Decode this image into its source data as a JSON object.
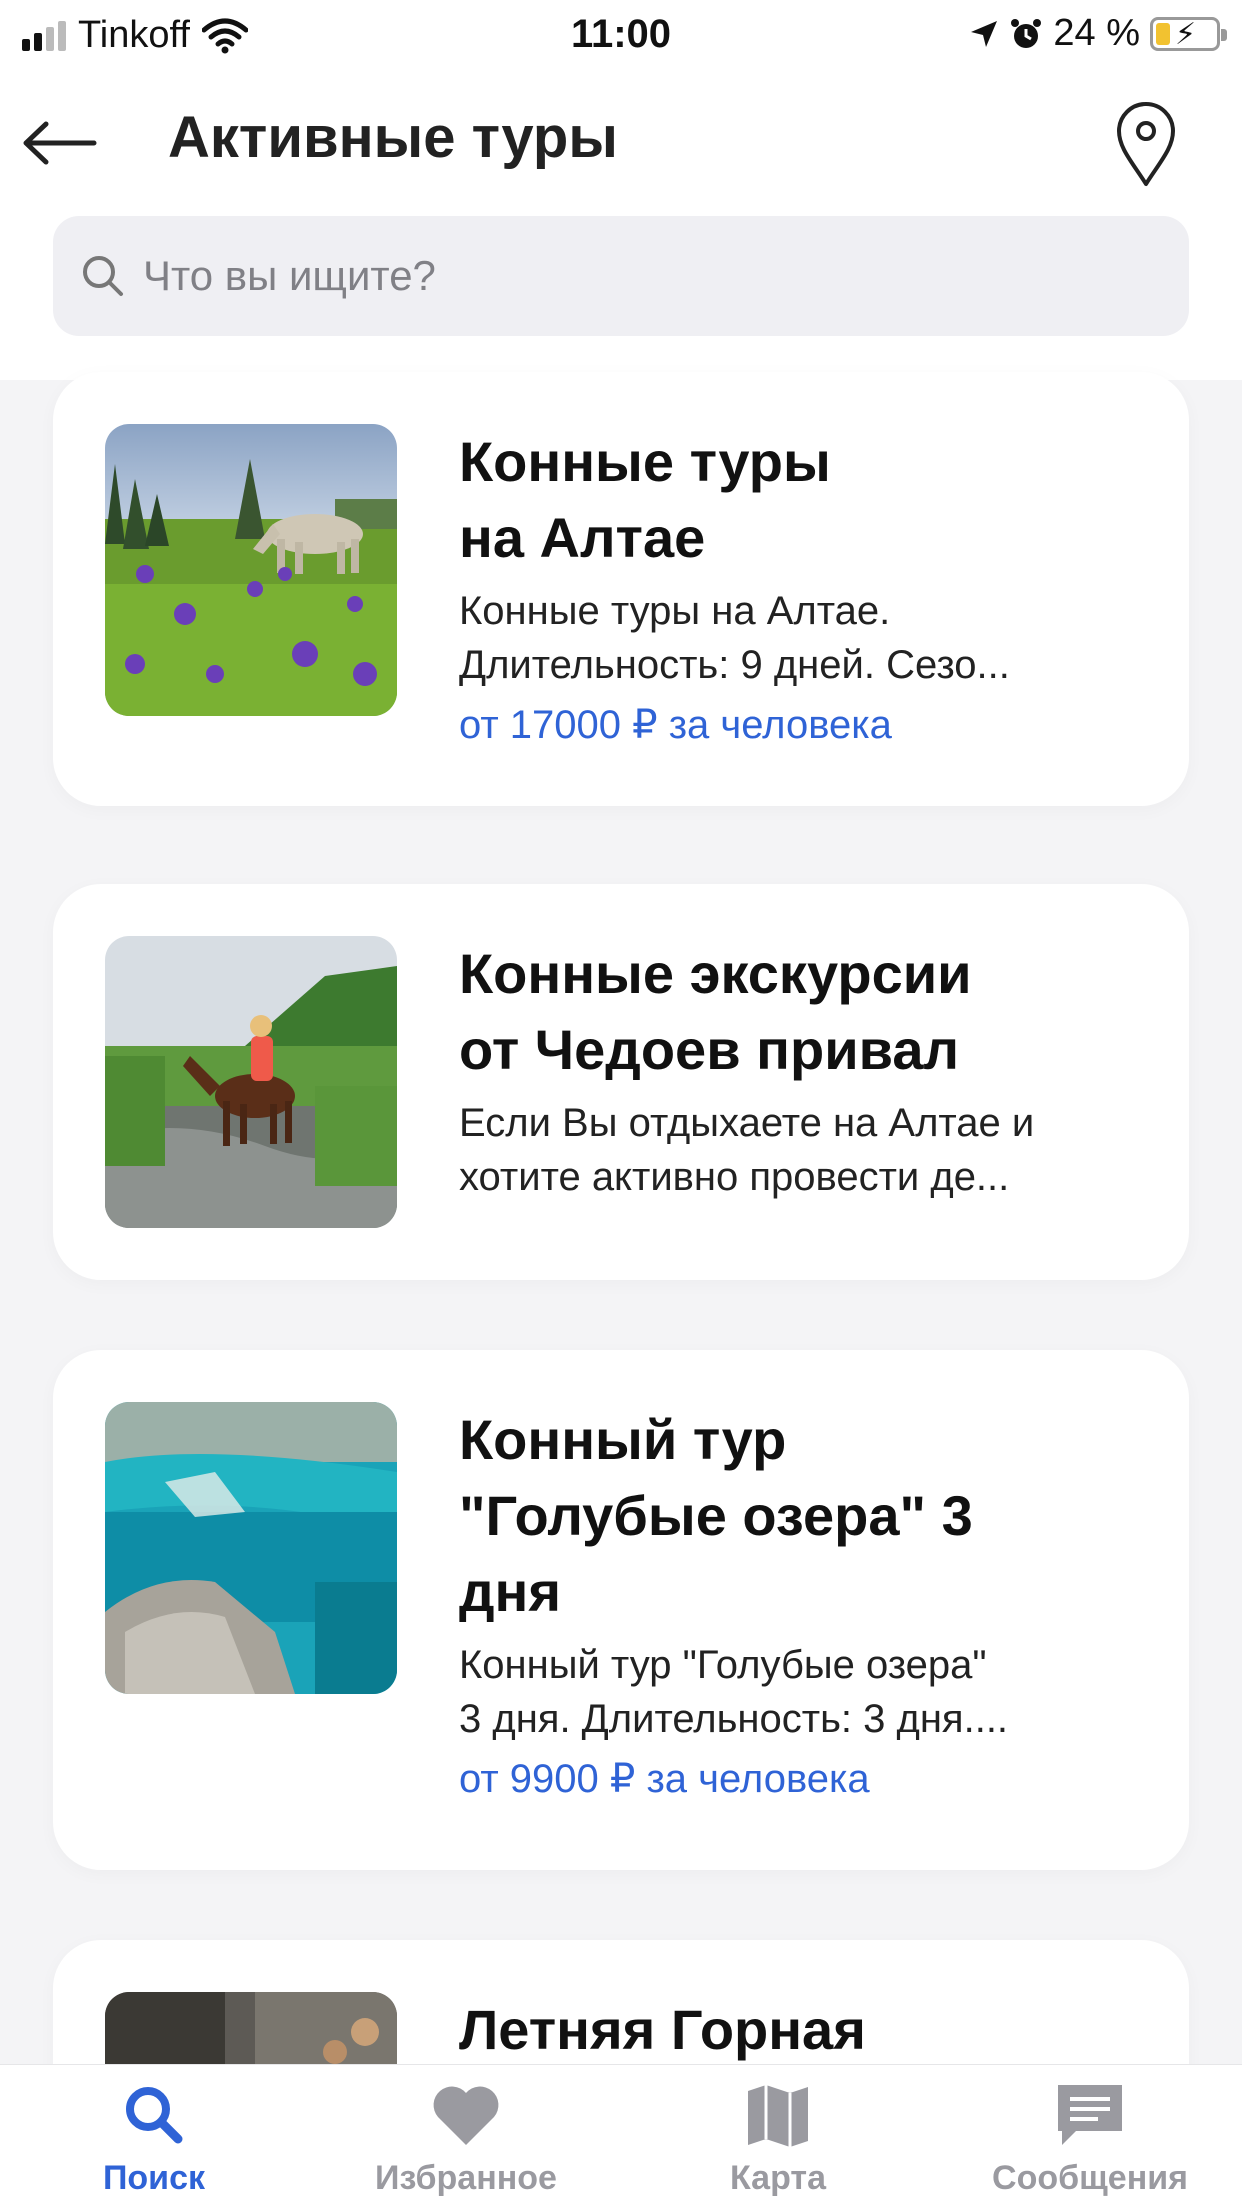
{
  "status_bar": {
    "carrier": "Tinkoff",
    "time": "11:00",
    "battery_percent": "24 %",
    "battery_level": 0.24
  },
  "header": {
    "title": "Активные туры",
    "search_placeholder": "Что вы ищите?"
  },
  "cards": [
    {
      "title_lines": [
        "Конные туры",
        "на Алтае"
      ],
      "desc_lines": [
        "Конные туры на Алтае.",
        "Длительность: 9 дней. Сезо..."
      ],
      "price": "от 17000 ₽ за человека"
    },
    {
      "title_lines": [
        "Конные экскурсии",
        "от Чедоев привал"
      ],
      "desc_lines": [
        "Если Вы отдыхаете на Алтае и",
        "хотите активно провести де..."
      ]
    },
    {
      "title_lines": [
        "Конный тур",
        "\"Голубые озера\" 3",
        "дня"
      ],
      "desc_lines": [
        "Конный тур \"Голубые озера\"",
        "3 дня. Длительность: 3 дня...."
      ],
      "price": "от 9900 ₽ за человека"
    },
    {
      "title_lines": [
        "Летняя Горная"
      ]
    }
  ],
  "tabbar": {
    "tabs": [
      {
        "label": "Поиск",
        "active": true
      },
      {
        "label": "Избранное"
      },
      {
        "label": "Карта"
      },
      {
        "label": "Сообщения"
      }
    ]
  },
  "colors": {
    "accent": "#2f63d6",
    "inactive": "#9a9aa0",
    "battery": "#f2c230"
  }
}
